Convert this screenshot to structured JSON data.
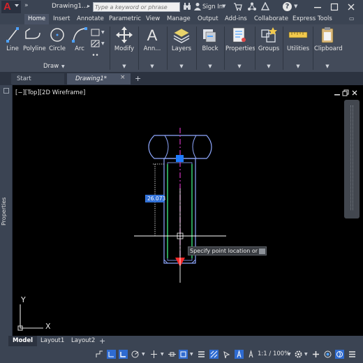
{
  "title_bar": {
    "document_title": "Drawing1...",
    "search_placeholder": "Type a keyword or phrase",
    "signin_label": "Sign In",
    "help_glyph": "?"
  },
  "ribbon_tabs": [
    "Home",
    "Insert",
    "Annotate",
    "Parametric",
    "View",
    "Manage",
    "Output",
    "Add-ins",
    "Collaborate",
    "Express Tools"
  ],
  "ribbon": {
    "draw_tools": [
      "Line",
      "Polyline",
      "Circle",
      "Arc"
    ],
    "draw_panel_label": "Draw",
    "big_tools": [
      "Modify",
      "Ann...",
      "Layers",
      "Block",
      "Properties",
      "Groups",
      "Utilities",
      "Clipboard"
    ]
  },
  "file_tabs": {
    "start": "Start",
    "drawing": "Drawing1*",
    "close_glyph": "×",
    "add_glyph": "+"
  },
  "left_palette": {
    "label": "Properties"
  },
  "viewport": {
    "view_label": "[−][Top][2D Wireframe]",
    "dynamic_input_value": "26.073",
    "tooltip_text": "Specify point location or",
    "ucs_x": "X",
    "ucs_y": "Y"
  },
  "layout_tabs": [
    "Model",
    "Layout1",
    "Layout2"
  ],
  "layout_add_glyph": "+",
  "status_bar": {
    "scale": "1:1 / 100%"
  },
  "colors": {
    "bolt_outline": "#8fa8ff",
    "selection_green": "#3ce07a",
    "center_line": "#c02fb0",
    "endpoint_marker": "#ff2b2b",
    "grip_blue": "#1e7bff",
    "crosshair": "#ffffff"
  }
}
